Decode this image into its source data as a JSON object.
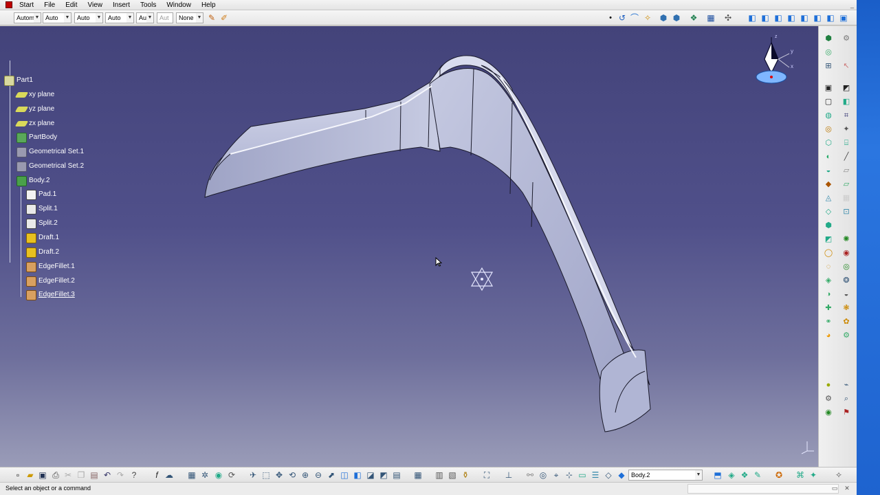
{
  "menubar": {
    "items": [
      "Start",
      "File",
      "Edit",
      "View",
      "Insert",
      "Tools",
      "Window",
      "Help"
    ]
  },
  "toolbar": {
    "combos": [
      {
        "value": "Autom",
        "disabled": false
      },
      {
        "value": "Auto",
        "disabled": false
      },
      {
        "value": "Auto",
        "disabled": false
      },
      {
        "value": "Auto",
        "disabled": false
      },
      {
        "value": "Aut",
        "disabled": false
      },
      {
        "value": "Aut",
        "disabled": true
      },
      {
        "value": "None",
        "disabled": false
      }
    ]
  },
  "tree": {
    "root": "Part1",
    "nodes": [
      {
        "label": "xy plane",
        "icon": "plane-icon"
      },
      {
        "label": "yz plane",
        "icon": "plane-icon"
      },
      {
        "label": "zx plane",
        "icon": "plane-icon"
      },
      {
        "label": "PartBody",
        "icon": "partbody-icon"
      },
      {
        "label": "Geometrical Set.1",
        "icon": "geometrical-set-icon"
      },
      {
        "label": "Geometrical Set.2",
        "icon": "geometrical-set-icon"
      },
      {
        "label": "Body.2",
        "icon": "body-icon"
      },
      {
        "label": "Pad.1",
        "icon": "pad-icon"
      },
      {
        "label": "Split.1",
        "icon": "split-icon"
      },
      {
        "label": "Split.2",
        "icon": "split-icon"
      },
      {
        "label": "Draft.1",
        "icon": "draft-icon"
      },
      {
        "label": "Draft.2",
        "icon": "draft-icon"
      },
      {
        "label": "EdgeFillet.1",
        "icon": "edge-fillet-icon"
      },
      {
        "label": "EdgeFillet.2",
        "icon": "edge-fillet-icon"
      },
      {
        "label": "EdgeFillet.3",
        "icon": "edge-fillet-icon"
      }
    ]
  },
  "compass": {
    "axis_y": "y",
    "axis_x": "x",
    "axis_z": "z"
  },
  "bottombar": {
    "body_select": "Body.2"
  },
  "status": {
    "message": "Select an object or a command"
  },
  "colors": {
    "viewport_top": "#43437a",
    "viewport_bottom": "#9a9cb8",
    "model_fill": "#b8bdd8",
    "model_edge": "#1a1a2a",
    "tree_text": "#ffffff",
    "windows_accent": "#1e63cf"
  }
}
